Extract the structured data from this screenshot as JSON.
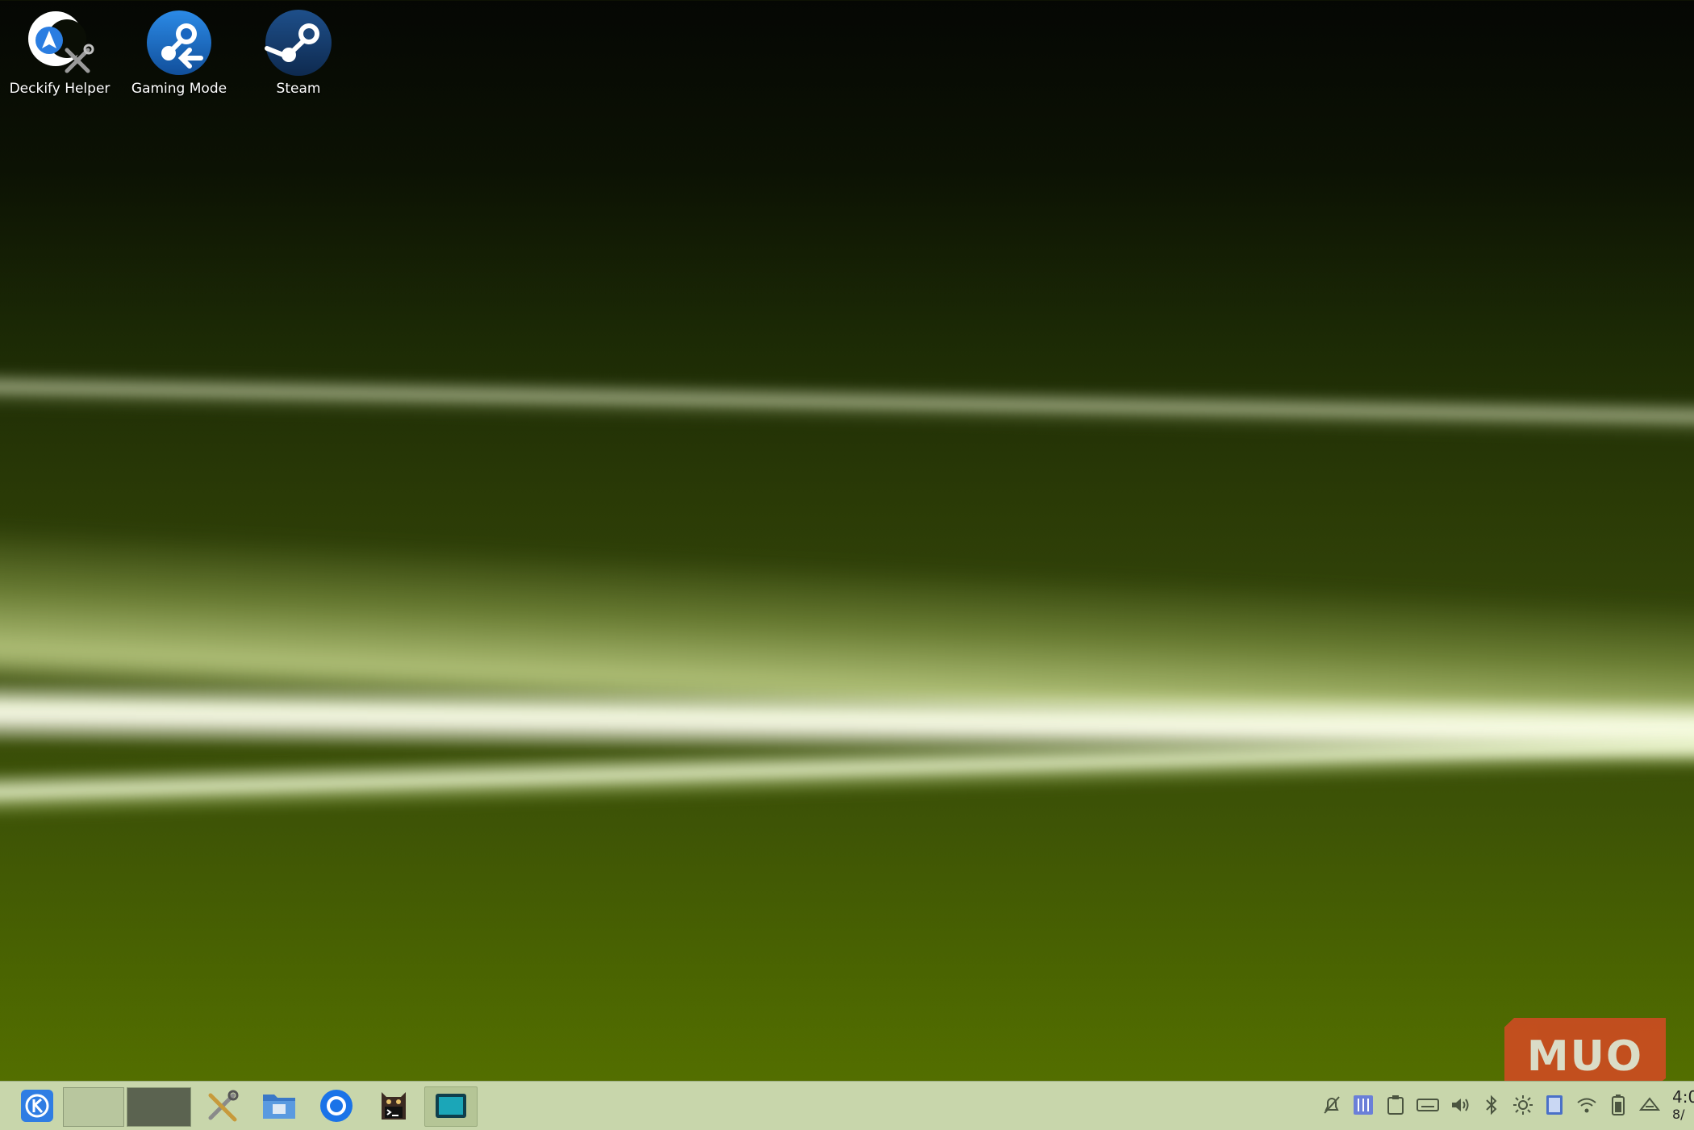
{
  "desktop": {
    "icons": [
      {
        "label": "Deckify Helper",
        "icon": "deckify-helper-icon"
      },
      {
        "label": "Gaming Mode",
        "icon": "gaming-mode-icon"
      },
      {
        "label": "Steam",
        "icon": "steam-icon"
      }
    ]
  },
  "taskbar": {
    "launcher_icon": "kde-launcher-icon",
    "pager_desktops": 2,
    "tasks": [
      {
        "icon": "system-tools-icon"
      },
      {
        "icon": "file-manager-icon"
      },
      {
        "icon": "chrome-icon"
      },
      {
        "icon": "terminal-icon"
      },
      {
        "icon": "screen-app-icon"
      }
    ],
    "tray": [
      "notifications-muted-icon",
      "audio-mixer-icon",
      "clipboard-icon",
      "keyboard-icon",
      "volume-icon",
      "bluetooth-icon",
      "brightness-icon",
      "display-icon",
      "wifi-icon",
      "battery-icon",
      "updates-icon"
    ],
    "clock_time": "4:0",
    "clock_date": "8/"
  },
  "watermark": {
    "text": "MUO"
  },
  "colors": {
    "taskbar_bg": "#c8d6ab",
    "steam_blue": "#1f5fa8",
    "watermark": "#d64a24"
  }
}
